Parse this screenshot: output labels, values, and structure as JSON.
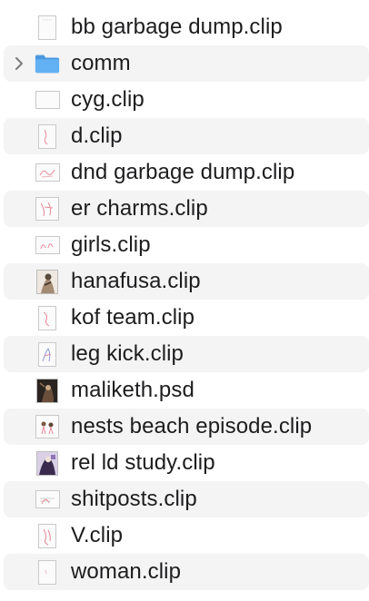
{
  "files": [
    {
      "name": "bb garbage dump.clip",
      "thumb": "doc-portrait-blank",
      "alt": false,
      "folder": false
    },
    {
      "name": "comm",
      "thumb": "folder-icon",
      "alt": true,
      "folder": true
    },
    {
      "name": "cyg.clip",
      "thumb": "doc-landscape-blank",
      "alt": false,
      "folder": false
    },
    {
      "name": "d.clip",
      "thumb": "doc-portrait-sketch",
      "alt": true,
      "folder": false
    },
    {
      "name": "dnd garbage dump.clip",
      "thumb": "doc-landscape-sketch",
      "alt": false,
      "folder": false
    },
    {
      "name": "er charms.clip",
      "thumb": "doc-square-sketch",
      "alt": true,
      "folder": false
    },
    {
      "name": "girls.clip",
      "thumb": "doc-landscape-sketch",
      "alt": false,
      "folder": false
    },
    {
      "name": "hanafusa.clip",
      "thumb": "photo-figure",
      "alt": true,
      "folder": false
    },
    {
      "name": "kof team.clip",
      "thumb": "doc-portrait-sketch",
      "alt": false,
      "folder": false
    },
    {
      "name": "leg kick.clip",
      "thumb": "doc-portrait-sketch-blue",
      "alt": true,
      "folder": false
    },
    {
      "name": "maliketh.psd",
      "thumb": "photo-dark",
      "alt": false,
      "folder": false
    },
    {
      "name": "nests beach episode.clip",
      "thumb": "doc-square-figures",
      "alt": true,
      "folder": false
    },
    {
      "name": "rel ld study.clip",
      "thumb": "photo-purple",
      "alt": false,
      "folder": false
    },
    {
      "name": "shitposts.clip",
      "thumb": "doc-landscape-sketch",
      "alt": true,
      "folder": false
    },
    {
      "name": "V.clip",
      "thumb": "doc-portrait-sketch",
      "alt": false,
      "folder": false
    },
    {
      "name": "woman.clip",
      "thumb": "doc-portrait-blank",
      "alt": true,
      "folder": false
    }
  ],
  "colors": {
    "folder": "#5aa9ee",
    "folder_tab": "#4b98e0",
    "sketch": "#e88a98",
    "row_alt": "#f4f4f4",
    "text": "#1d1d1f"
  }
}
